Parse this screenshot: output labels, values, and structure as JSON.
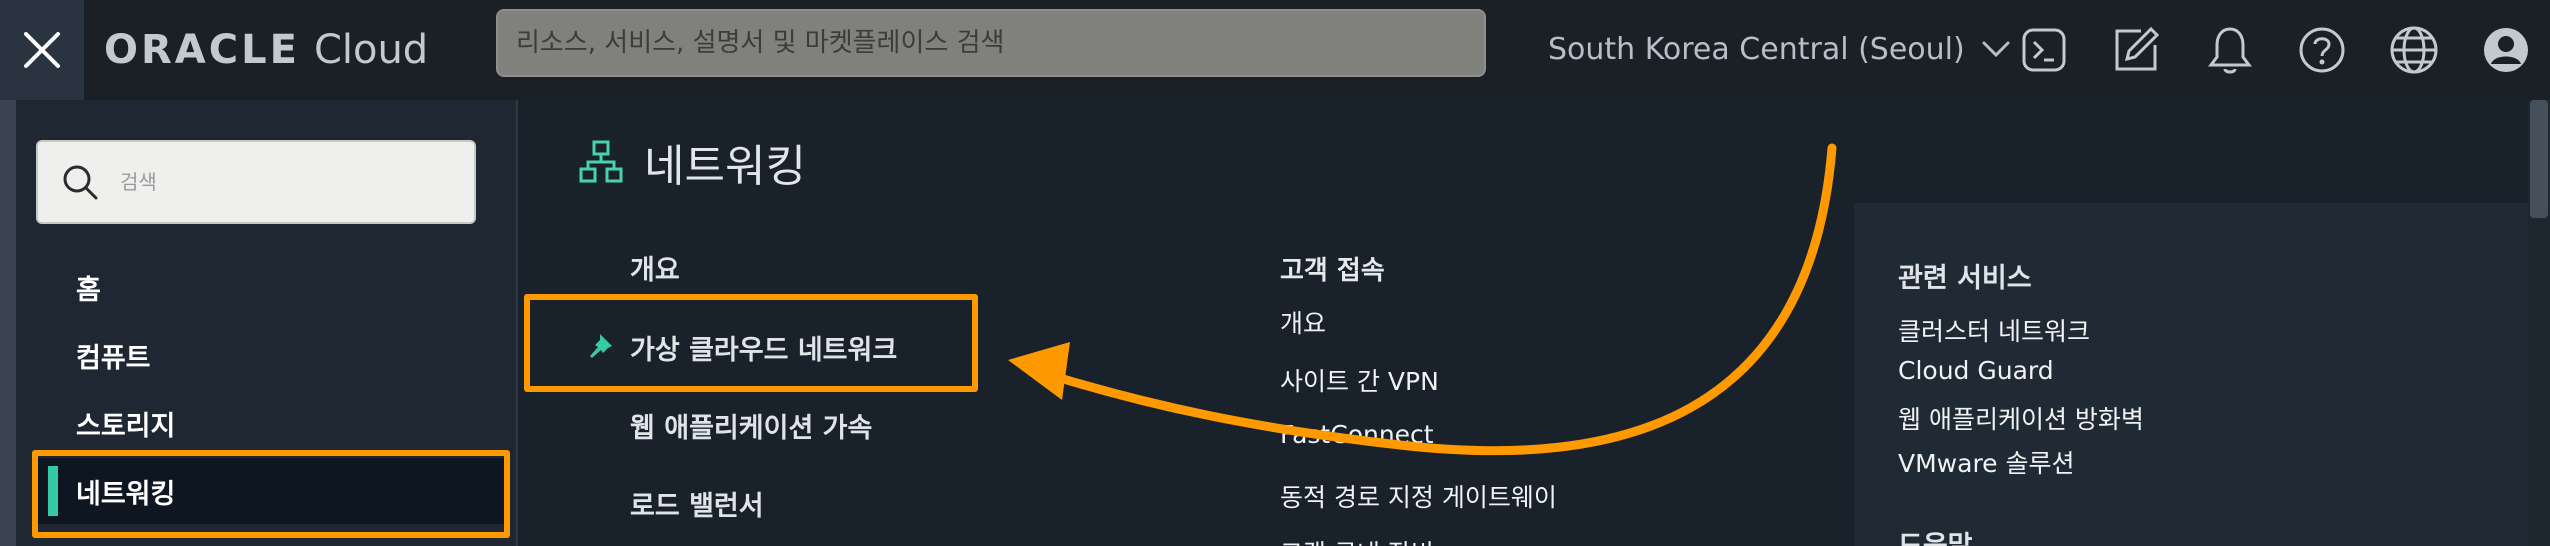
{
  "colors": {
    "accent": "#ff9900",
    "active_marker": "#35c9a4",
    "link": "#f0f2f4"
  },
  "topbar": {
    "logo_brand": "ORACLE",
    "logo_product": "Cloud",
    "search_placeholder": "리소스, 서비스, 설명서 및 마켓플레이스 검색",
    "region": "South Korea Central (Seoul)",
    "icons": [
      "close-icon",
      "cloud-shell-icon",
      "edit-icon",
      "bell-icon",
      "help-icon",
      "globe-icon",
      "user-icon"
    ]
  },
  "sidebar": {
    "search_placeholder": "검색",
    "items": [
      {
        "label": "홈"
      },
      {
        "label": "컴퓨트"
      },
      {
        "label": "스토리지"
      },
      {
        "label": "네트워킹",
        "active": true
      }
    ]
  },
  "main": {
    "title": "네트워킹",
    "col1": {
      "items": [
        {
          "label": "개요"
        },
        {
          "label": "가상 클라우드 네트워크",
          "pinned": true
        },
        {
          "label": "웹 애플리케이션 가속"
        },
        {
          "label": "로드 밸런서"
        }
      ]
    },
    "col2": {
      "heading": "고객 접속",
      "items": [
        {
          "label": "개요"
        },
        {
          "label": "사이트 간 VPN"
        },
        {
          "label": "FastConnect"
        },
        {
          "label": "동적 경로 지정 게이트웨이"
        },
        {
          "label": "고객 구내 장비"
        }
      ]
    },
    "col3": {
      "heading": "관련 서비스",
      "items": [
        {
          "label": "클러스터 네트워크"
        },
        {
          "label": "Cloud Guard"
        },
        {
          "label": "웹 애플리케이션 방화벽"
        },
        {
          "label": "VMware 솔루션"
        }
      ],
      "heading2": "도움말"
    }
  }
}
